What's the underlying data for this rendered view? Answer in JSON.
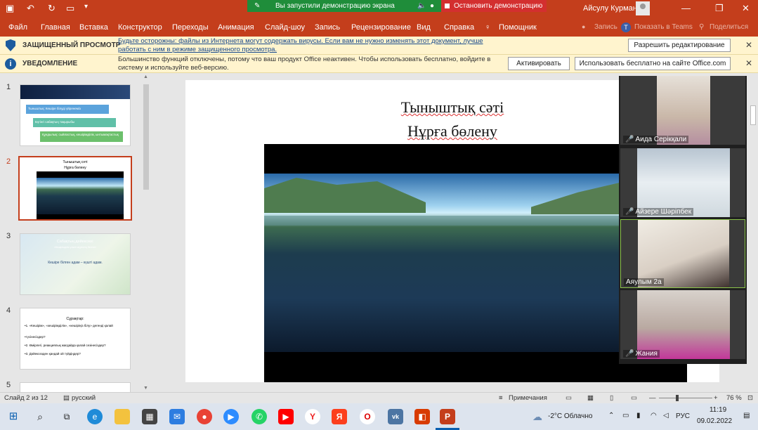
{
  "titlebar": {
    "share_status": "Вы запустили демонстрацию экрана",
    "stop_share": "Остановить демонстрацию",
    "user_name": "Айсулу Курман"
  },
  "ribbon": {
    "tabs": [
      "Файл",
      "Главная",
      "Вставка",
      "Конструктор",
      "Переходы",
      "Анимация",
      "Слайд-шоу",
      "Запись",
      "Рецензирование",
      "Вид",
      "Справка",
      "Помощник"
    ],
    "right_items": [
      "Запись",
      "Показать в Teams",
      "Поделиться"
    ]
  },
  "protected_view": {
    "label": "ЗАЩИЩЕННЫЙ ПРОСМОТР",
    "text": "Будьте осторожны: файлы из Интернета могут содержать вирусы. Если вам не нужно изменять этот документ, лучше работать с ним в режиме защищенного просмотра.",
    "button": "Разрешить редактирование"
  },
  "notice": {
    "label": "УВЕДОМЛЕНИЕ",
    "text": "Большинство функций отключены, потому что ваш продукт Office неактивен. Чтобы использовать бесплатно, войдите в систему и используйте веб-версию.",
    "activate_button": "Активировать",
    "free_button": "Использовать бесплатно на сайте Office.com"
  },
  "thumbnails": {
    "numbers": [
      "1",
      "2",
      "3",
      "4",
      "5"
    ],
    "slide1": {
      "lines": [
        "Тыныштық: Кешіре білуді үйренеміз",
        "Бүгінгі сабақтың тақырыбы",
        "Құндылық: сыйластық, кешірімділік, ынтымақтастық"
      ]
    },
    "slide2": {
      "title1": "Тыныштық сәті",
      "title2": "Нұрға бөлену"
    },
    "slide3": {
      "title": "Сабақтың дәйексөзі:",
      "subtitle": "«Кешірімділік үлкен жүректің белгісі»",
      "body": "Кешіре білген адам – күшті адам."
    },
    "slide4": {
      "title": "Сұрақтар:",
      "lines": [
        "•1. «Кешірім», «кешірімділік», «кешіріңіз білу» дегенді қалай",
        "•түсінесіздер?",
        "•2. Өмірлегі, реакциялық жағдайда қалай сезінесіздер?",
        "•3. Дәйексөзден қандай ой түйдіңдер?"
      ]
    }
  },
  "slide": {
    "title_line1": "Тыныштық сәті",
    "title_line2": "Нұрға бөлену"
  },
  "participants": [
    {
      "name": "Аида Серікқали"
    },
    {
      "name": "Айзере Шәріпбек"
    },
    {
      "name": "Аяулым 2а"
    },
    {
      "name": "Жания"
    }
  ],
  "status": {
    "slide_info": "Слайд 2 из 12",
    "language": "русский",
    "notes": "Примечания",
    "zoom": "76 %"
  },
  "taskbar": {
    "weather": "-2°C Облачно",
    "lang": "РУС",
    "time": "11:19",
    "date": "09.02.2022"
  }
}
